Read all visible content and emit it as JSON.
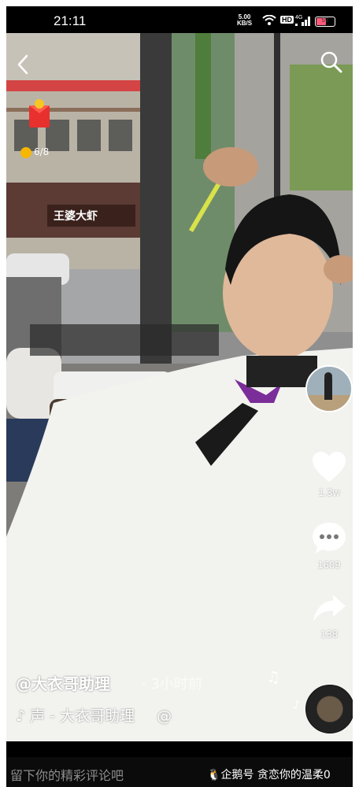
{
  "status_bar": {
    "time": "21:11",
    "net_speed": "5.00",
    "net_unit": "KB/S",
    "hd": "HD",
    "network": "4G",
    "battery": "59",
    "battery_level": 0.59
  },
  "top": {
    "back_icon": "back-arrow-icon",
    "search_icon": "search-icon",
    "red_packet_icon": "red-packet-icon",
    "red_packet_progress": "6/8"
  },
  "scene_sign": "王婆大虾",
  "side_actions": {
    "like_count": "1.3w",
    "comment_count": "1609",
    "share_count": "138"
  },
  "video_info": {
    "author": "@大衣哥助理",
    "posted": "· 3小时前",
    "music": "声 - 大衣哥助理",
    "music_tail": "@"
  },
  "comment_bar": {
    "placeholder": "留下你的精彩评论吧"
  },
  "watermark": "企鹅号 贪恋你的温柔0",
  "colors": {
    "like": "#ffffff",
    "accent_red": "#fe2c55",
    "cape": "#f3f3f1",
    "collar": "#7b2d99"
  }
}
